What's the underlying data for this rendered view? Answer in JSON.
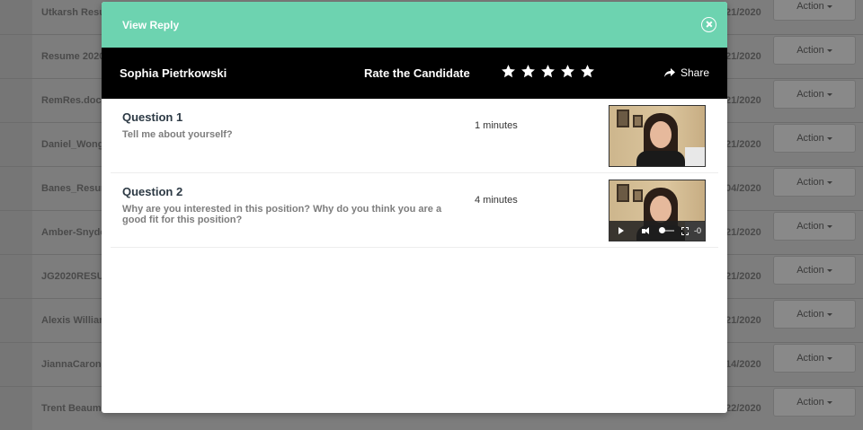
{
  "background": {
    "rows": [
      {
        "name": "Utkarsh Resu",
        "date": "21/2020",
        "action": "Action"
      },
      {
        "name": "Resume 2020",
        "date": "21/2020",
        "action": "Action"
      },
      {
        "name": "RemRes.docx",
        "date": "21/2020",
        "action": "Action"
      },
      {
        "name": "Daniel_Wong",
        "date": "21/2020",
        "action": "Action"
      },
      {
        "name": "Banes_Resum",
        "date": "04/2020",
        "action": "Action"
      },
      {
        "name": "Amber-Snyde",
        "date": "21/2020",
        "action": "Action"
      },
      {
        "name": "JG2020RESU",
        "date": "21/2020",
        "action": "Action"
      },
      {
        "name": "Alexis Willian",
        "date": "21/2020",
        "action": "Action"
      },
      {
        "name": "JiannaCarona",
        "date": "14/2020",
        "action": "Action"
      },
      {
        "name": "Trent Beaum",
        "date": "22/2020",
        "action": "Action"
      }
    ]
  },
  "modal": {
    "title": "View Reply",
    "candidate_name": "Sophia Pietrkowski",
    "rate_label": "Rate the Candidate",
    "stars": 5,
    "share_label": "Share",
    "questions": [
      {
        "title": "Question 1",
        "text": "Tell me about yourself?",
        "duration": "1 minutes",
        "show_controls": false
      },
      {
        "title": "Question 2",
        "text": "Why are you interested in this position? Why do you think you are a good fit for this position?",
        "duration": "4 minutes",
        "show_controls": true,
        "video_time": "-0"
      }
    ]
  }
}
